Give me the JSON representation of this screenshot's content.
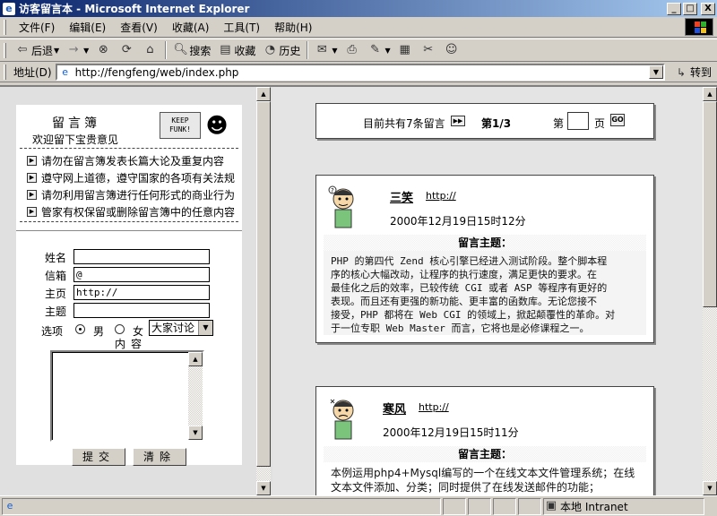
{
  "window": {
    "title": "访客留言本 - Microsoft Internet Explorer",
    "minimize": "_",
    "maximize": "□",
    "close": "X"
  },
  "menubar": {
    "items": [
      "文件(F)",
      "编辑(E)",
      "查看(V)",
      "收藏(A)",
      "工具(T)",
      "帮助(H)"
    ]
  },
  "toolbar": {
    "back": "后退",
    "forward": "→",
    "search": "搜索",
    "favorites": "收藏",
    "history": "历史"
  },
  "address": {
    "label": "地址(D)",
    "url": "http://fengfeng/web/index.php",
    "go": "转到"
  },
  "guestbook_form": {
    "title": "留言簿",
    "subtitle": "欢迎留下宝贵意见",
    "logo_text": "KEEP FUNK!",
    "rules": [
      "请勿在留言簿发表长篇大论及重复内容",
      "遵守网上道德，遵守国家的各项有关法规",
      "请勿利用留言簿进行任何形式的商业行为",
      "管家有权保留或删除留言簿中的任意内容"
    ],
    "labels": {
      "name": "姓名",
      "email": "信箱",
      "homepage": "主页",
      "subject": "主题",
      "options": "选项",
      "male": "男",
      "female": "女",
      "content": "内容"
    },
    "values": {
      "name": "",
      "email": "@",
      "homepage": "http://",
      "subject": ""
    },
    "category_selected": "大家讨论",
    "submit": "提交",
    "clear": "清除"
  },
  "pagination": {
    "summary": "目前共有7条留言",
    "page_status": "第1/3",
    "goto_prefix": "第",
    "goto_suffix": "页",
    "go": "GO"
  },
  "posts": [
    {
      "author": "三笑",
      "link": "http://",
      "date": "2000年12月19日15时12分",
      "topic_label": "留言主题：",
      "body": [
        "PHP 的第四代 Zend 核心引擎已经进入测试阶段。整个脚本程",
        "序的核心大幅改动，让程序的执行速度，满足更快的要求。在",
        "最佳化之后的效率，已较传统 CGI 或者 ASP 等程序有更好的",
        "表现。而且还有更强的新功能、更丰富的函数库。无论您接不",
        "接受，PHP 都将在 Web CGI 的领域上，掀起颠覆性的革命。对",
        "于一位专职 Web Master 而言，它将也是必修课程之一。"
      ]
    },
    {
      "author": "寒风",
      "link": "http://",
      "date": "2000年12月19日15时11分",
      "topic_label": "留言主题：",
      "body": [
        "本例运用php4+Mysql编写的一个在线文本文件管理系统；在线",
        "文本文件添加、分类；同时提供了在线发送邮件的功能；"
      ]
    }
  ],
  "status": {
    "zone": "本地 Intranet"
  }
}
